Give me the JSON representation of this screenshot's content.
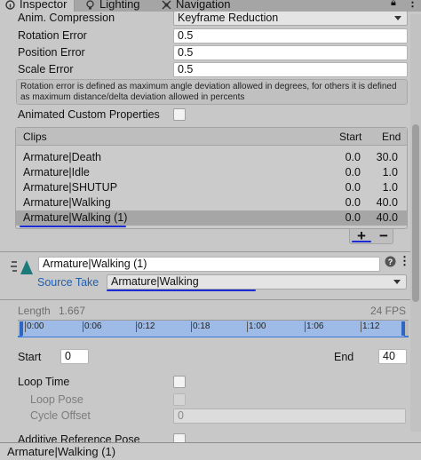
{
  "tabs": [
    {
      "label": "Inspector",
      "active": true
    },
    {
      "label": "Lighting",
      "active": false
    },
    {
      "label": "Navigation",
      "active": false
    }
  ],
  "anim": {
    "compression_label": "Anim. Compression",
    "compression_value": "Keyframe Reduction",
    "rotation_label": "Rotation Error",
    "rotation_value": "0.5",
    "position_label": "Position Error",
    "position_value": "0.5",
    "scale_label": "Scale Error",
    "scale_value": "0.5",
    "help": "Rotation error is defined as maximum angle deviation allowed in degrees, for others it is defined as maximum distance/delta deviation allowed in percents",
    "custom_props_label": "Animated Custom Properties"
  },
  "clips": {
    "header": {
      "name": "Clips",
      "start": "Start",
      "end": "End"
    },
    "rows": [
      {
        "name": "Armature|Death",
        "start": "0.0",
        "end": "30.0"
      },
      {
        "name": "Armature|Idle",
        "start": "0.0",
        "end": "1.0"
      },
      {
        "name": "Armature|SHUTUP",
        "start": "0.0",
        "end": "1.0"
      },
      {
        "name": "Armature|Walking",
        "start": "0.0",
        "end": "40.0"
      },
      {
        "name": "Armature|Walking (1)",
        "start": "0.0",
        "end": "40.0",
        "selected": true
      }
    ],
    "add": "+",
    "remove": "−"
  },
  "clip_settings": {
    "name_value": "Armature|Walking (1)",
    "source_take_label": "Source Take",
    "source_take_value": "Armature|Walking",
    "length_label": "Length",
    "length_value": "1.667",
    "fps": "24 FPS",
    "ticks": [
      "0:00",
      "0:06",
      "0:12",
      "0:18",
      "1:00",
      "1:06",
      "1:12"
    ],
    "start_label": "Start",
    "start_value": "0",
    "end_label": "End",
    "end_value": "40",
    "loop_time_label": "Loop Time",
    "loop_pose_label": "Loop Pose",
    "cycle_offset_label": "Cycle Offset",
    "cycle_offset_value": "0",
    "additive_label": "Additive Reference Pose"
  },
  "footer": {
    "title": "Armature|Walking (1)"
  },
  "colors": {
    "accent": "#2f66c2",
    "link": "#1f5fb3",
    "annotation_ink": "#1b2bd6"
  }
}
